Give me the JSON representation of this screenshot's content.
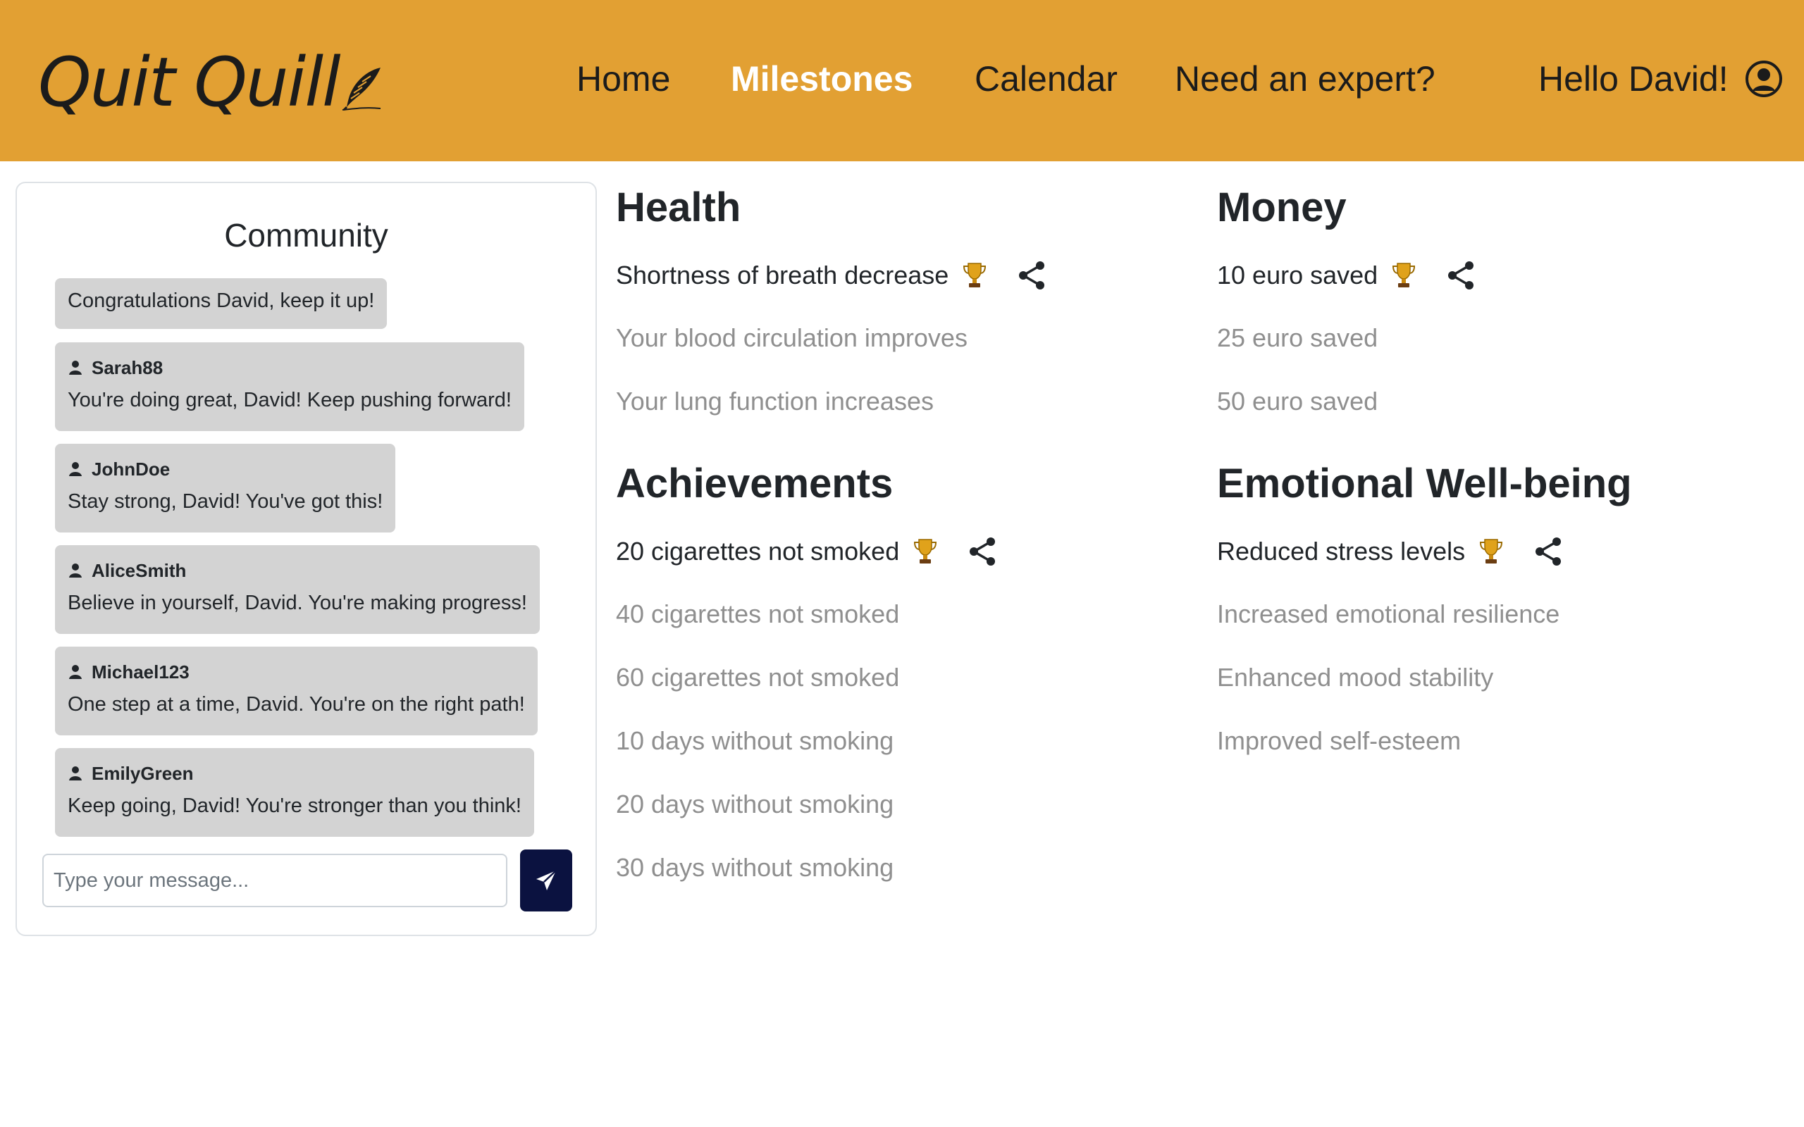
{
  "header": {
    "logo_text": "Quit Quill",
    "nav": [
      {
        "label": "Home",
        "active": false
      },
      {
        "label": "Milestones",
        "active": true
      },
      {
        "label": "Calendar",
        "active": false
      },
      {
        "label": "Need an expert?",
        "active": false
      }
    ],
    "greeting": "Hello David!",
    "user_icon": "user-circle-icon"
  },
  "community": {
    "title": "Community",
    "messages": [
      {
        "user": "",
        "text": "Congratulations David, keep it up!"
      },
      {
        "user": "Sarah88",
        "text": "You're doing great, David! Keep pushing forward!"
      },
      {
        "user": "JohnDoe",
        "text": "Stay strong, David! You've got this!"
      },
      {
        "user": "AliceSmith",
        "text": "Believe in yourself, David. You're making progress!"
      },
      {
        "user": "Michael123",
        "text": "One step at a time, David. You're on the right path!"
      },
      {
        "user": "EmilyGreen",
        "text": "Keep going, David! You're stronger than you think!"
      }
    ],
    "input_placeholder": "Type your message...",
    "input_value": "",
    "send_icon": "paper-plane-icon"
  },
  "milestones": {
    "health": {
      "title": "Health",
      "achieved": "Shortness of breath decrease",
      "upcoming": [
        "Your blood circulation improves",
        "Your lung function increases"
      ]
    },
    "money": {
      "title": "Money",
      "achieved": "10 euro saved",
      "upcoming": [
        "25 euro saved",
        "50 euro saved"
      ]
    },
    "achievements": {
      "title": "Achievements",
      "achieved": "20 cigarettes not smoked",
      "upcoming": [
        "40 cigarettes not smoked",
        "60 cigarettes not smoked",
        "10 days without smoking",
        "20 days without smoking",
        "30 days without smoking"
      ]
    },
    "emotional": {
      "title": "Emotional Well-being",
      "achieved": "Reduced stress levels",
      "upcoming": [
        "Increased emotional resilience",
        "Enhanced mood stability",
        "Improved self-esteem"
      ]
    }
  },
  "colors": {
    "header_bg": "#e2a033",
    "bubble_bg": "#d3d3d3",
    "send_button": "#0b1240",
    "upcoming_text": "#8f8f8f"
  }
}
